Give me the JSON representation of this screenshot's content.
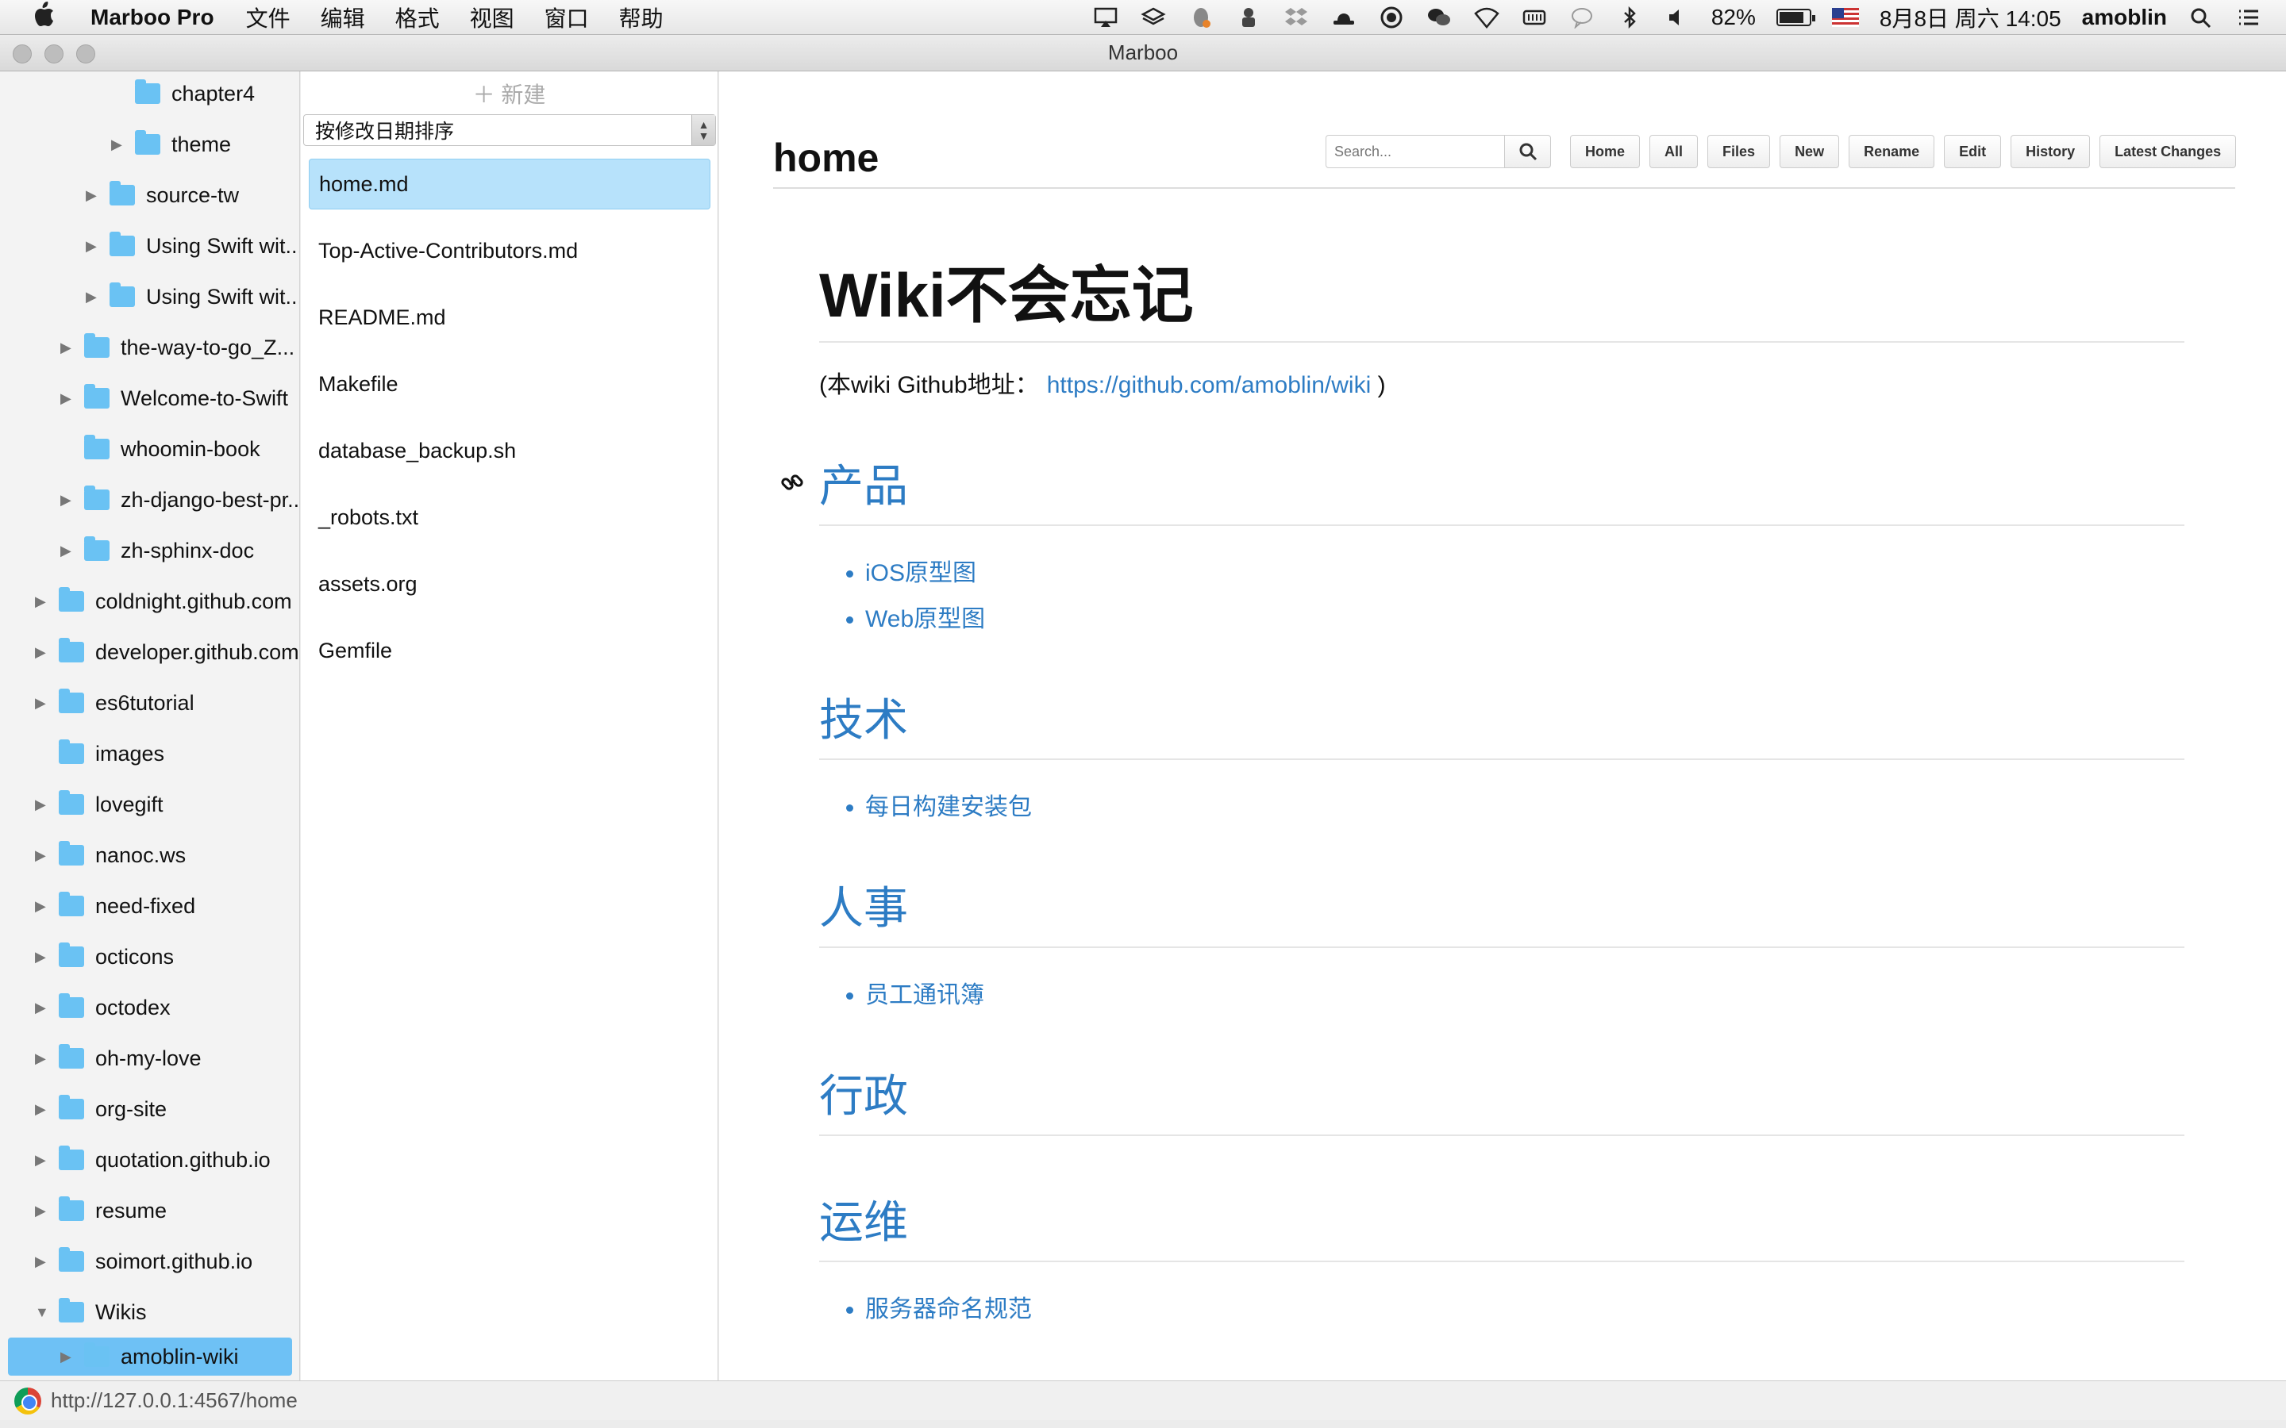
{
  "menubar": {
    "app_name": "Marboo Pro",
    "items": [
      "文件",
      "编辑",
      "格式",
      "视图",
      "窗口",
      "帮助"
    ],
    "battery": "82%",
    "battery_level": 0.82,
    "datetime": "8月8日 周六 14:05",
    "username": "amoblin"
  },
  "window": {
    "title": "Marboo"
  },
  "tree": [
    {
      "label": "chapter4"
    },
    {
      "label": "theme"
    },
    {
      "label": "source-tw"
    },
    {
      "label": "Using Swift wit..."
    },
    {
      "label": "Using Swift wit..."
    },
    {
      "label": "the-way-to-go_Z..."
    },
    {
      "label": "Welcome-to-Swift"
    },
    {
      "label": "whoomin-book"
    },
    {
      "label": "zh-django-best-pr..."
    },
    {
      "label": "zh-sphinx-doc"
    },
    {
      "label": "coldnight.github.com"
    },
    {
      "label": "developer.github.com"
    },
    {
      "label": "es6tutorial"
    },
    {
      "label": "images"
    },
    {
      "label": "lovegift"
    },
    {
      "label": "nanoc.ws"
    },
    {
      "label": "need-fixed"
    },
    {
      "label": "octicons"
    },
    {
      "label": "octodex"
    },
    {
      "label": "oh-my-love"
    },
    {
      "label": "org-site"
    },
    {
      "label": "quotation.github.io"
    },
    {
      "label": "resume"
    },
    {
      "label": "soimort.github.io"
    },
    {
      "label": "Wikis"
    },
    {
      "label": "amoblin-wiki"
    }
  ],
  "filelist": {
    "new_label": "＋ 新建",
    "sort_label": "按修改日期排序",
    "files": [
      "home.md",
      "Top-Active-Contributors.md",
      "README.md",
      "Makefile",
      "database_backup.sh",
      "_robots.txt",
      "assets.org",
      "Gemfile"
    ]
  },
  "wiki": {
    "page_title": "home",
    "search_placeholder": "Search...",
    "buttons": [
      "Home",
      "All",
      "Files",
      "New",
      "Rename",
      "Edit",
      "History",
      "Latest Changes"
    ],
    "heading": "Wiki不会忘记",
    "intro_prefix": "(本wiki Github地址：",
    "intro_link": "https://github.com/amoblin/wiki",
    "intro_suffix": ")",
    "sections": [
      {
        "title": "产品",
        "items": [
          "iOS原型图",
          "Web原型图"
        ]
      },
      {
        "title": "技术",
        "items": [
          "每日构建安装包"
        ]
      },
      {
        "title": "人事",
        "items": [
          "员工通讯簿"
        ]
      },
      {
        "title": "行政",
        "items": []
      },
      {
        "title": "运维",
        "items": [
          "服务器命名规范"
        ]
      }
    ]
  },
  "statusbar": {
    "url": "http://127.0.0.1:4567/home"
  },
  "colors": {
    "link": "#2d7cc4",
    "selection": "#6ec1f5",
    "folder": "#6ac2f3"
  }
}
